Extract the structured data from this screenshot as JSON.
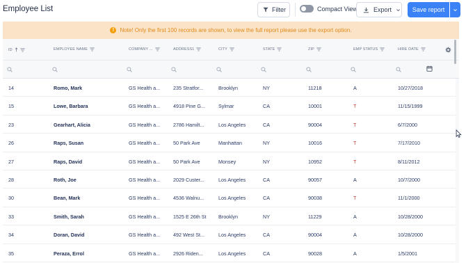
{
  "header": {
    "title": "Employee List",
    "filter_label": "Filter",
    "compact_view_label": "Compact View",
    "export_label": "Export",
    "save_report_label": "Save report"
  },
  "notice": {
    "text": "Note! Only the first 100 records are shown, to view the full report please use the export option."
  },
  "columns": [
    "ID",
    "EMPLOYEE NAME",
    "COMPANY ...",
    "ADDRESS1",
    "CITY",
    "STATE",
    "ZIP",
    "EMP STATUS",
    "HIRE DATE"
  ],
  "rows": [
    {
      "id": "14",
      "name": "Romo, Mark",
      "company": "GS Health a...",
      "address": "235 Stratfor...",
      "city": "Brooklyn",
      "state": "NY",
      "zip": "11218",
      "status": "A",
      "hire_date": "10/27/2018"
    },
    {
      "id": "15",
      "name": "Lowe, Barbara",
      "company": "GS Health a...",
      "address": "4918 Pine G...",
      "city": "Sylmar",
      "state": "CA",
      "zip": "10001",
      "status": "T",
      "hire_date": "11/15/1999"
    },
    {
      "id": "23",
      "name": "Gearhart, Alicia",
      "company": "GS Health a...",
      "address": "2786 Hamilt...",
      "city": "Los Angeles",
      "state": "CA",
      "zip": "90004",
      "status": "T",
      "hire_date": "6/7/2000"
    },
    {
      "id": "26",
      "name": "Raps, Susan",
      "company": "GS Health a...",
      "address": "50 Park Ave",
      "city": "Manhattan",
      "state": "NY",
      "zip": "10016",
      "status": "T",
      "hire_date": "7/17/2010"
    },
    {
      "id": "27",
      "name": "Raps, David",
      "company": "GS Health a...",
      "address": "50 Park Ave",
      "city": "Monsey",
      "state": "NY",
      "zip": "10952",
      "status": "T",
      "hire_date": "8/11/2012"
    },
    {
      "id": "28",
      "name": "Roth, Joe",
      "company": "GS Health a...",
      "address": "2029 Custer...",
      "city": "Los Angeles",
      "state": "CA",
      "zip": "90057",
      "status": "A",
      "hire_date": "10/7/2000"
    },
    {
      "id": "30",
      "name": "Bean, Mark",
      "company": "GS Health a...",
      "address": "4536 Walnu...",
      "city": "Los Angeles",
      "state": "CA",
      "zip": "90038",
      "status": "T",
      "hire_date": "11/1/2000"
    },
    {
      "id": "33",
      "name": "Smith, Sarah",
      "company": "GS Health a...",
      "address": "1525 E 26th St",
      "city": "Brooklyn",
      "state": "NY",
      "zip": "11229",
      "status": "A",
      "hire_date": "10/28/2000"
    },
    {
      "id": "34",
      "name": "Doran, David",
      "company": "GS Health a...",
      "address": "492 West St...",
      "city": "Los Angeles",
      "state": "CA",
      "zip": "90004",
      "status": "A",
      "hire_date": "10/28/2000"
    },
    {
      "id": "35",
      "name": "Peraza, Errol",
      "company": "GS Health a...",
      "address": "2926 Riden...",
      "city": "Los Angeles",
      "state": "CA",
      "zip": "90028",
      "status": "A",
      "hire_date": "1/5/2001"
    }
  ],
  "colors": {
    "accent": "#3b82f6",
    "notice_bg": "#fbe3c7",
    "notice_text": "#e08a1a",
    "status_terminated": "#c0392b"
  },
  "icons": [
    "filter-icon",
    "toggle-switch",
    "download-icon",
    "chevron-down-icon",
    "warning-icon",
    "sort-up-icon",
    "column-filter-icon",
    "settings-gear-icon",
    "search-icon",
    "calendar-icon"
  ]
}
